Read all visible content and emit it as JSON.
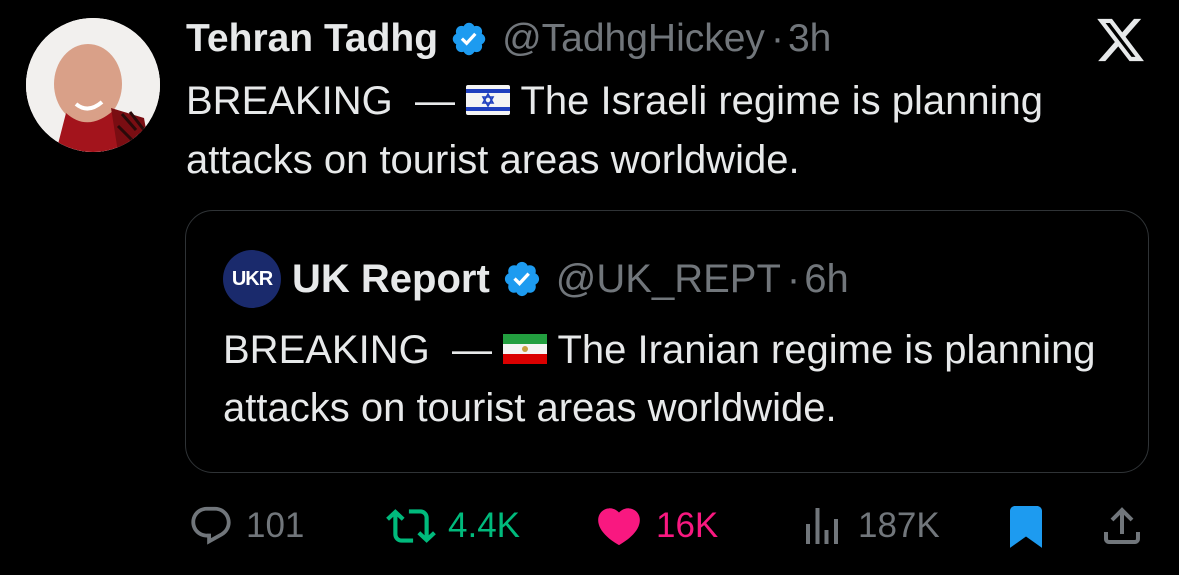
{
  "tweet": {
    "author_name": "Tehran Tadhg",
    "author_handle": "@TadhgHickey",
    "time_sep": "·",
    "time": "3h",
    "text_prefix": "BREAKING  —",
    "text_body": "The Israeli regime is planning attacks on tourist areas worldwide."
  },
  "quote": {
    "avatar_text": "UKR",
    "author_name": "UK Report",
    "author_handle": "@UK_REPT",
    "time_sep": "·",
    "time": "6h",
    "text_prefix": "BREAKING  —",
    "text_body": "The Iranian regime is planning attacks on tourist areas worldwide."
  },
  "actions": {
    "replies": "101",
    "reposts": "4.4K",
    "likes": "16K",
    "views": "187K"
  },
  "colors": {
    "background": "#000000",
    "verified": "#1d9bf0",
    "repost": "#00ba7c",
    "like": "#f91880",
    "bookmark": "#1d9bf0",
    "muted": "#71767b"
  },
  "icons": [
    "verified-badge-icon",
    "x-logo-icon",
    "israel-flag-icon",
    "iran-flag-icon",
    "reply-icon",
    "repost-icon",
    "heart-icon",
    "views-icon",
    "bookmark-icon",
    "share-icon"
  ]
}
